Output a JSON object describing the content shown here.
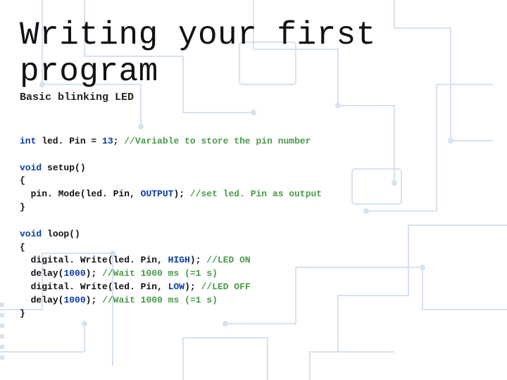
{
  "title": "Writing your first program",
  "subtitle": "Basic blinking LED",
  "code": {
    "l1": {
      "kw": "int",
      "ident": " led. Pin = ",
      "num": "13",
      "punct": "; ",
      "cmt": "//Variable to store the pin number"
    },
    "l2": "",
    "l3": {
      "kw": "void",
      "fn": " setup",
      "punct": "()"
    },
    "l4": "{",
    "l5": {
      "indent": "  ",
      "fn": "pin. Mode",
      "p1": "(led. Pin, ",
      "const": "OUTPUT",
      "p2": "); ",
      "cmt": "//set led. Pin as output"
    },
    "l6": "}",
    "l7": "",
    "l8": {
      "kw": "void",
      "fn": " loop",
      "punct": "()"
    },
    "l9": "{",
    "l10": {
      "indent": "  ",
      "fn": "digital. Write",
      "p1": "(led. Pin, ",
      "const": "HIGH",
      "p2": "); ",
      "cmt": "//LED ON"
    },
    "l11": {
      "indent": "  ",
      "fn": "delay",
      "p1": "(",
      "num": "1000",
      "p2": "); ",
      "cmt": "//Wait 1000 ms (=1 s)"
    },
    "l12": {
      "indent": "  ",
      "fn": "digital. Write",
      "p1": "(led. Pin, ",
      "const": "LOW",
      "p2": "); ",
      "cmt": "//LED OFF"
    },
    "l13": {
      "indent": "  ",
      "fn": "delay",
      "p1": "(",
      "num": "1000",
      "p2": "); ",
      "cmt": "//Wait 1000 ms (=1 s)"
    },
    "l14": "}"
  }
}
